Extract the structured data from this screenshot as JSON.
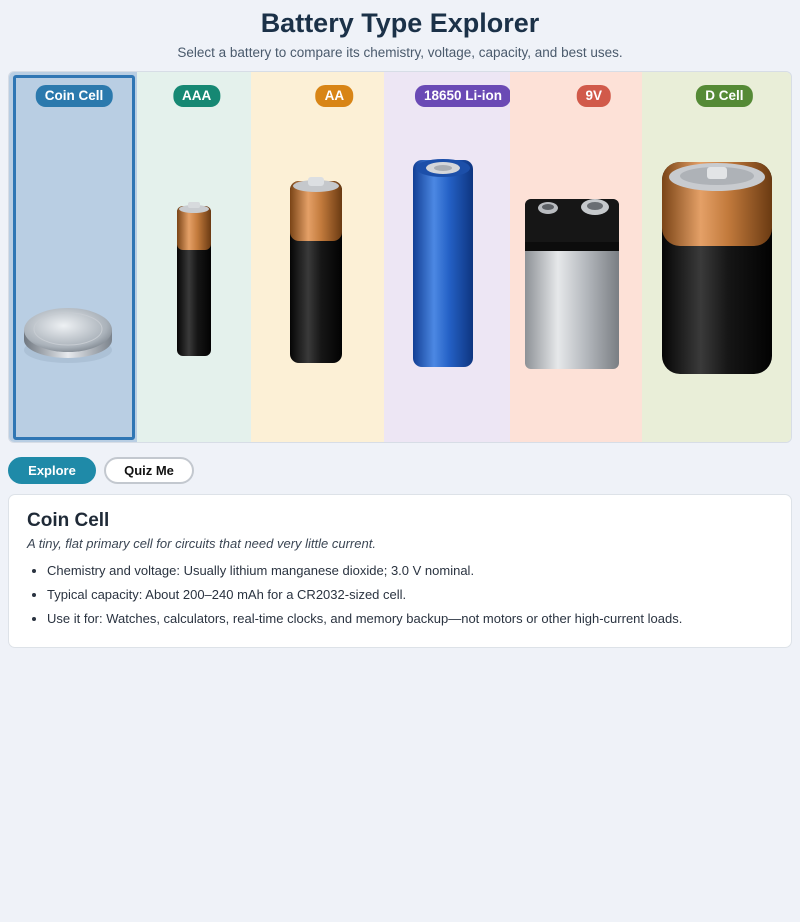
{
  "header": {
    "title": "Battery Type Explorer",
    "subtitle": "Select a battery to compare its chemistry, voltage, capacity, and best uses."
  },
  "batteries": [
    {
      "label": "Coin Cell",
      "badge_color": "#2b79ad",
      "bg": "#b9cee3",
      "selected": true,
      "icon": "coin-cell-battery-icon"
    },
    {
      "label": "AAA",
      "badge_color": "#168873",
      "bg": "#e4f1ec",
      "selected": false,
      "icon": "aaa-battery-icon"
    },
    {
      "label": "AA",
      "badge_color": "#d88516",
      "bg": "#fcf0d6",
      "selected": false,
      "icon": "aa-battery-icon"
    },
    {
      "label": "18650 Li-ion",
      "badge_color": "#6a4ab5",
      "bg": "#ede6f4",
      "selected": false,
      "icon": "18650-battery-icon"
    },
    {
      "label": "9V",
      "badge_color": "#d15a4a",
      "bg": "#fde1d7",
      "selected": false,
      "icon": "9v-battery-icon"
    },
    {
      "label": "D Cell",
      "badge_color": "#558a36",
      "bg": "#e9eed8",
      "selected": false,
      "icon": "d-cell-battery-icon"
    }
  ],
  "modes": {
    "explore_label": "Explore",
    "quiz_label": "Quiz Me"
  },
  "details": {
    "name": "Coin Cell",
    "description": "A tiny, flat primary cell for circuits that need very little current.",
    "facts": [
      "Chemistry and voltage: Usually lithium manganese dioxide; 3.0 V nominal.",
      "Typical capacity: About 200–240 mAh for a CR2032-sized cell.",
      "Use it for: Watches, calculators, real-time clocks, and memory backup—not motors or other high-current loads."
    ]
  }
}
